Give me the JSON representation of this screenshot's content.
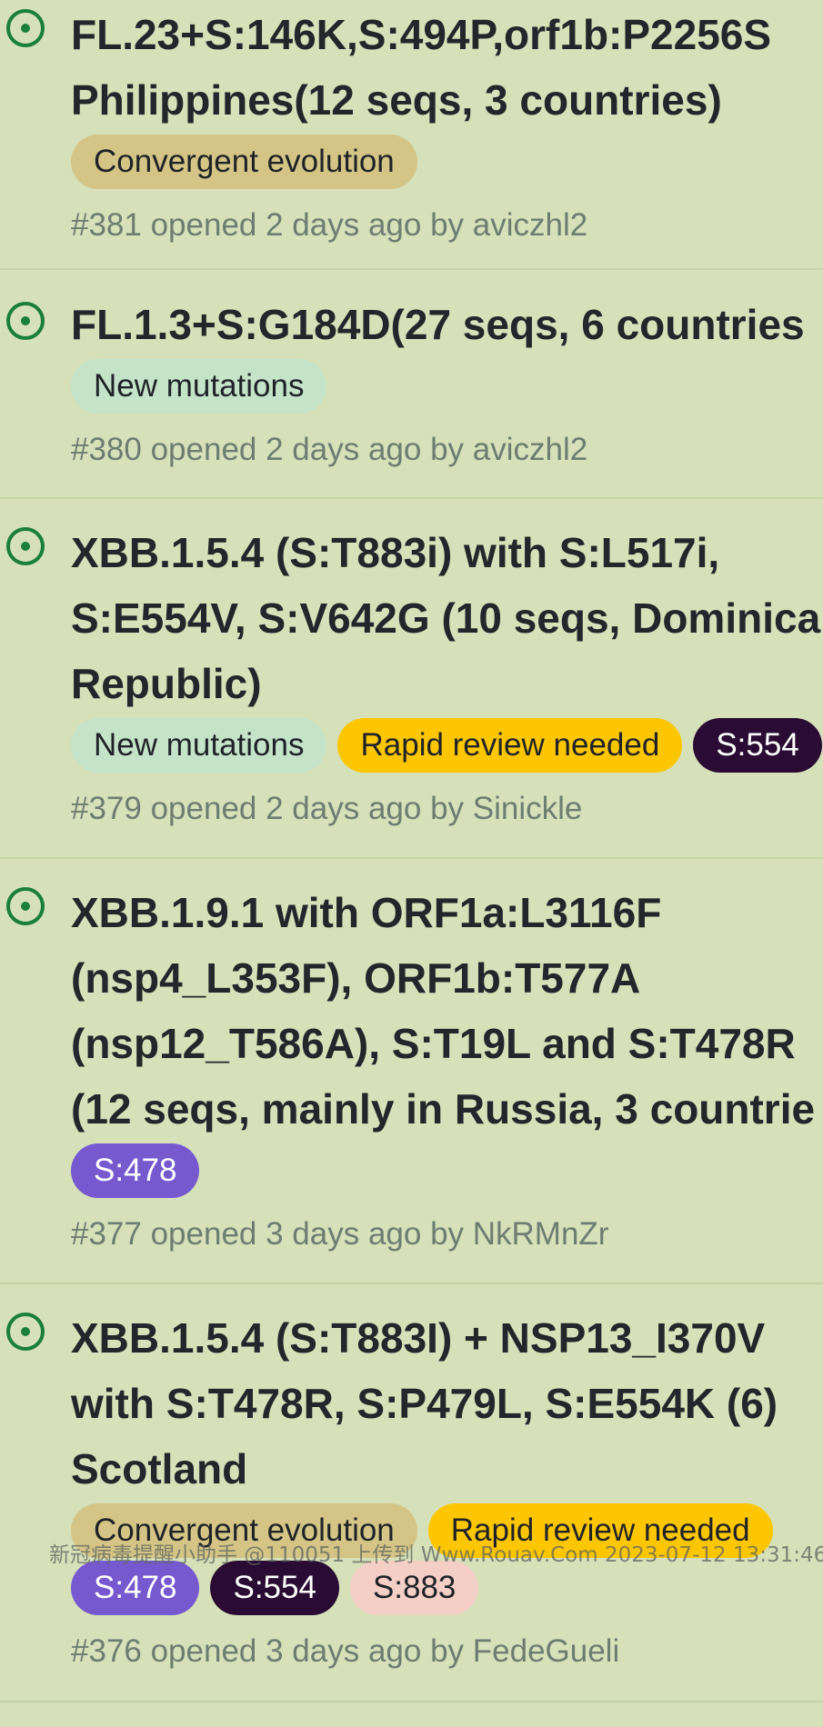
{
  "issues": [
    {
      "title_lines": [
        "FL.23+S:146K,S:494P,orf1b:P2256S",
        "Philippines(12 seqs, 3 countries)"
      ],
      "labels": [
        {
          "text": "Convergent evolution",
          "bg": "#d4c587",
          "fg": "#1f2328"
        }
      ],
      "meta": "#381 opened 2 days ago by aviczhl2",
      "state_icon": "open-issue-icon"
    },
    {
      "title_lines": [
        "FL.1.3+S:G184D(27 seqs, 6 countries"
      ],
      "labels": [
        {
          "text": "New mutations",
          "bg": "#c5e3c8",
          "fg": "#1f2328"
        }
      ],
      "meta": "#380 opened 2 days ago by aviczhl2",
      "state_icon": "open-issue-icon"
    },
    {
      "title_lines": [
        "XBB.1.5.4 (S:T883i) with S:L517i,",
        "S:E554V, S:V642G (10 seqs, Dominica",
        "Republic)"
      ],
      "labels": [
        {
          "text": "New mutations",
          "bg": "#c5e3c8",
          "fg": "#1f2328"
        },
        {
          "text": "Rapid review needed",
          "bg": "#fcc603",
          "fg": "#1f2328"
        },
        {
          "text": "S:554",
          "bg": "#2a0b33",
          "fg": "#ffffff"
        }
      ],
      "meta": "#379 opened 2 days ago by Sinickle",
      "state_icon": "open-issue-icon"
    },
    {
      "title_lines": [
        "XBB.1.9.1 with ORF1a:L3116F",
        "(nsp4_L353F), ORF1b:T577A",
        "(nsp12_T586A), S:T19L and S:T478R",
        "(12 seqs, mainly in Russia, 3 countrie"
      ],
      "labels": [
        {
          "text": "S:478",
          "bg": "#7659cf",
          "fg": "#ffffff"
        }
      ],
      "meta": "#377 opened 3 days ago by NkRMnZr",
      "state_icon": "open-issue-icon"
    },
    {
      "title_lines": [
        "XBB.1.5.4 (S:T883I) + NSP13_I370V",
        "with S:T478R, S:P479L, S:E554K (6)",
        "Scotland"
      ],
      "labels": [
        {
          "text": "Convergent evolution",
          "bg": "#d4c587",
          "fg": "#1f2328"
        },
        {
          "text": "Rapid review needed",
          "bg": "#fcc603",
          "fg": "#1f2328"
        }
      ],
      "labels_row2": [
        {
          "text": "S:478",
          "bg": "#7659cf",
          "fg": "#ffffff"
        },
        {
          "text": "S:554",
          "bg": "#2a0b33",
          "fg": "#ffffff"
        },
        {
          "text": "S:883",
          "bg": "#f4cfc6",
          "fg": "#1f2328"
        }
      ],
      "meta": "#376 opened 3 days ago by FedeGueli",
      "state_icon": "open-issue-icon"
    }
  ],
  "watermark": "新冠病毒提醒小助手 @110051 上传到 Www.Rouav.Com 2023-07-12 13:31:46",
  "colors": {
    "background": "#d6e0b9",
    "open_icon": "#1a7f37",
    "title": "#23262b",
    "meta": "#6e7d72",
    "divider": "#c2d4a4"
  }
}
